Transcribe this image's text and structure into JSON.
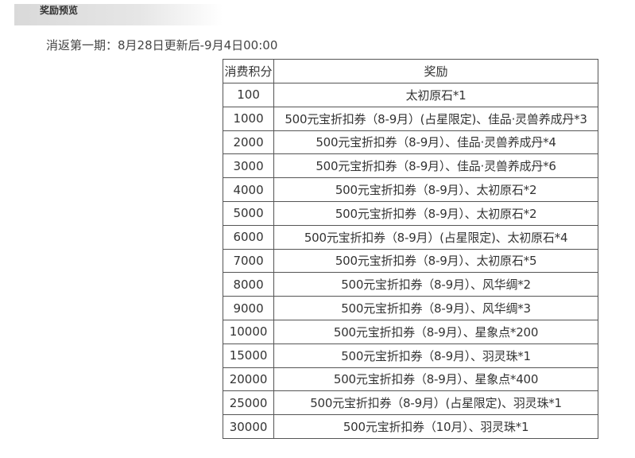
{
  "header": {
    "title": "奖励预览"
  },
  "period": {
    "text": "消返第一期：8月28日更新后-9月4日00:00"
  },
  "table": {
    "columns": [
      "消费积分",
      "奖励"
    ],
    "rows": [
      {
        "points": "100",
        "reward": "太初原石*1"
      },
      {
        "points": "1000",
        "reward": "500元宝折扣券（8-9月）(占星限定)、佳品·灵兽养成丹*3"
      },
      {
        "points": "2000",
        "reward": "500元宝折扣券（8-9月）、佳品·灵兽养成丹*4"
      },
      {
        "points": "3000",
        "reward": "500元宝折扣券（8-9月）、佳品·灵兽养成丹*6"
      },
      {
        "points": "4000",
        "reward": "500元宝折扣券（8-9月）、太初原石*2"
      },
      {
        "points": "5000",
        "reward": "500元宝折扣券（8-9月）、太初原石*2"
      },
      {
        "points": "6000",
        "reward": "500元宝折扣券（8-9月）(占星限定)、太初原石*4"
      },
      {
        "points": "7000",
        "reward": "500元宝折扣券（8-9月）、太初原石*5"
      },
      {
        "points": "8000",
        "reward": "500元宝折扣券（8-9月）、风华绸*2"
      },
      {
        "points": "9000",
        "reward": "500元宝折扣券（8-9月）、风华绸*3"
      },
      {
        "points": "10000",
        "reward": "500元宝折扣券（8-9月）、星象点*200"
      },
      {
        "points": "15000",
        "reward": "500元宝折扣券（8-9月）、羽灵珠*1"
      },
      {
        "points": "20000",
        "reward": "500元宝折扣券（8-9月）、星象点*400"
      },
      {
        "points": "25000",
        "reward": "500元宝折扣券（8-9月）(占星限定)、羽灵珠*1"
      },
      {
        "points": "30000",
        "reward": "500元宝折扣券（10月）、羽灵珠*1"
      }
    ]
  }
}
